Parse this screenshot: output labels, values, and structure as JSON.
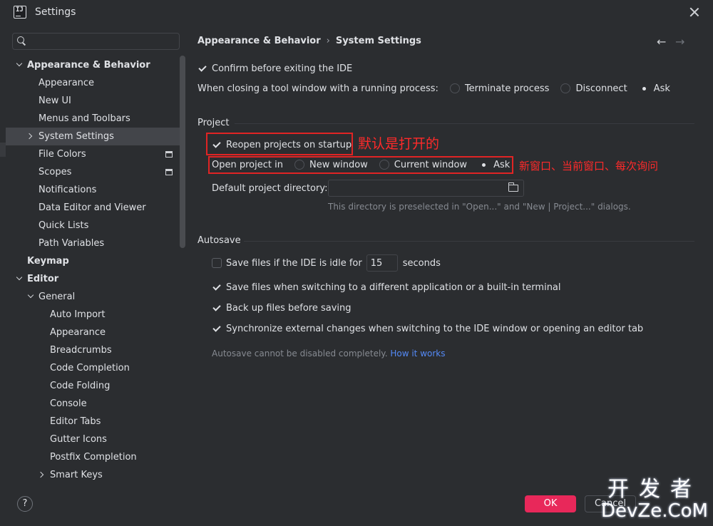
{
  "window": {
    "title": "Settings"
  },
  "search": {
    "placeholder": ""
  },
  "sidebar": {
    "items": [
      {
        "label": "Appearance & Behavior",
        "level": 0,
        "expand": "down",
        "bold": true
      },
      {
        "label": "Appearance",
        "level": 1
      },
      {
        "label": "New UI",
        "level": 1
      },
      {
        "label": "Menus and Toolbars",
        "level": 1
      },
      {
        "label": "System Settings",
        "level": 1,
        "expand": "right",
        "selected": true
      },
      {
        "label": "File Colors",
        "level": 1,
        "project_icon": true
      },
      {
        "label": "Scopes",
        "level": 1,
        "project_icon": true
      },
      {
        "label": "Notifications",
        "level": 1
      },
      {
        "label": "Data Editor and Viewer",
        "level": 1
      },
      {
        "label": "Quick Lists",
        "level": 1
      },
      {
        "label": "Path Variables",
        "level": 1
      },
      {
        "label": "Keymap",
        "level": 0,
        "bold": true
      },
      {
        "label": "Editor",
        "level": 0,
        "expand": "down",
        "bold": true
      },
      {
        "label": "General",
        "level": 1,
        "expand": "down"
      },
      {
        "label": "Auto Import",
        "level": 2
      },
      {
        "label": "Appearance",
        "level": 2
      },
      {
        "label": "Breadcrumbs",
        "level": 2
      },
      {
        "label": "Code Completion",
        "level": 2
      },
      {
        "label": "Code Folding",
        "level": 2
      },
      {
        "label": "Console",
        "level": 2
      },
      {
        "label": "Editor Tabs",
        "level": 2
      },
      {
        "label": "Gutter Icons",
        "level": 2
      },
      {
        "label": "Postfix Completion",
        "level": 2
      },
      {
        "label": "Smart Keys",
        "level": 2,
        "expand": "right"
      }
    ]
  },
  "breadcrumb": {
    "parent": "Appearance & Behavior",
    "separator": "›",
    "current": "System Settings"
  },
  "nav": {
    "back": "←",
    "forward": "→"
  },
  "general": {
    "confirm_exit": {
      "label": "Confirm before exiting the IDE",
      "checked": true
    },
    "closing_tool_window": {
      "label": "When closing a tool window with a running process:",
      "options": [
        "Terminate process",
        "Disconnect",
        "Ask"
      ],
      "selected": "Ask"
    }
  },
  "project": {
    "title": "Project",
    "reopen": {
      "label": "Reopen projects on startup",
      "checked": true
    },
    "open_in": {
      "label": "Open project in",
      "options": [
        "New window",
        "Current window",
        "Ask"
      ],
      "selected": "Ask"
    },
    "default_dir": {
      "label": "Default project directory:",
      "value": ""
    },
    "default_dir_hint": "This directory is preselected in \"Open...\" and \"New | Project...\" dialogs."
  },
  "annotations": {
    "reopen_note": "默认是打开的",
    "open_in_note": "新窗口、当前窗口、每次询问"
  },
  "autosave": {
    "title": "Autosave",
    "idle": {
      "label_before": "Save files if the IDE is idle for",
      "value": "15",
      "label_after": "seconds",
      "checked": false
    },
    "switching": {
      "label": "Save files when switching to a different application or a built-in terminal",
      "checked": true
    },
    "backup": {
      "label": "Back up files before saving",
      "checked": true
    },
    "sync": {
      "label": "Synchronize external changes when switching to the IDE window or opening an editor tab",
      "checked": true
    },
    "note": "Autosave cannot be disabled completely.",
    "note_link": "How it works"
  },
  "footer": {
    "help": "?",
    "ok": "OK",
    "cancel": "Cancel"
  },
  "watermark": {
    "top": "开发者",
    "bottom": "DevZe.CoM"
  },
  "colors": {
    "background": "#2b2d30",
    "selection": "#43454a",
    "accent_ok": "#e8285a",
    "annotation_red": "#e02424",
    "link": "#548af7"
  }
}
